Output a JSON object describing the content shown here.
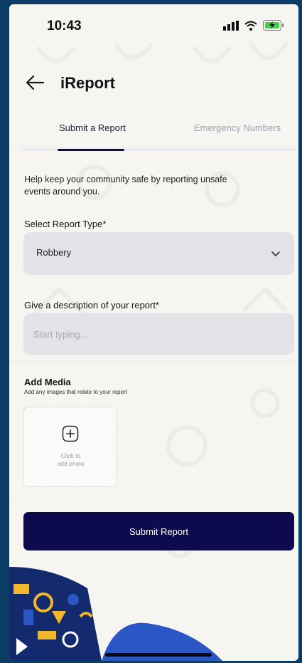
{
  "status_bar": {
    "time": "10:43"
  },
  "header": {
    "title": "iReport"
  },
  "tabs": [
    {
      "label": "Submit a Report",
      "active": true
    },
    {
      "label": "Emergency Numbers",
      "active": false
    }
  ],
  "form": {
    "intro": "Help keep your community safe by reporting unsafe events around you.",
    "report_type_label": "Select Report Type*",
    "report_type_value": "Robbery",
    "description_label": "Give a description of your report*",
    "description_placeholder": "Start typing...",
    "media_title": "Add Media",
    "media_subtitle": "Add any images that relate to your report",
    "upload_line1": "Click to",
    "upload_line2": "add photo",
    "submit_label": "Submit Report"
  },
  "colors": {
    "primary": "#0d0b4e",
    "field_bg": "#e3e3e7",
    "page_bg": "#f6f5f2",
    "frame": "#0b3d66",
    "decor_blue": "#2b56c6",
    "decor_yellow": "#f2b829"
  },
  "icons": [
    "signal-icon",
    "wifi-icon",
    "battery-charging-icon",
    "back-arrow-icon",
    "chevron-down-icon",
    "add-photo-plus-icon"
  ]
}
